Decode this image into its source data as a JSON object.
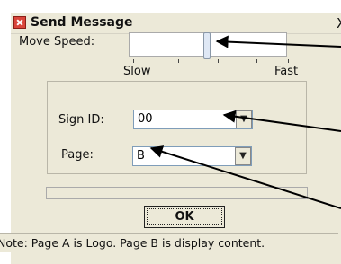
{
  "window": {
    "title": "Send Message",
    "close_glyph": "X"
  },
  "move_speed": {
    "label": "Move Speed:",
    "slow_label": "Slow",
    "fast_label": "Fast",
    "level": 0.52
  },
  "sign_id": {
    "label": "Sign ID:",
    "value": "00"
  },
  "page": {
    "label": "Page:",
    "value": "B"
  },
  "ok_label": "OK",
  "status": {
    "note": "Note: Page  A is Logo. Page B is display content."
  },
  "icons": {
    "window_icon": "app-icon",
    "dropdown": "chevron-down-icon",
    "arrow": "callout-arrow-icon"
  }
}
